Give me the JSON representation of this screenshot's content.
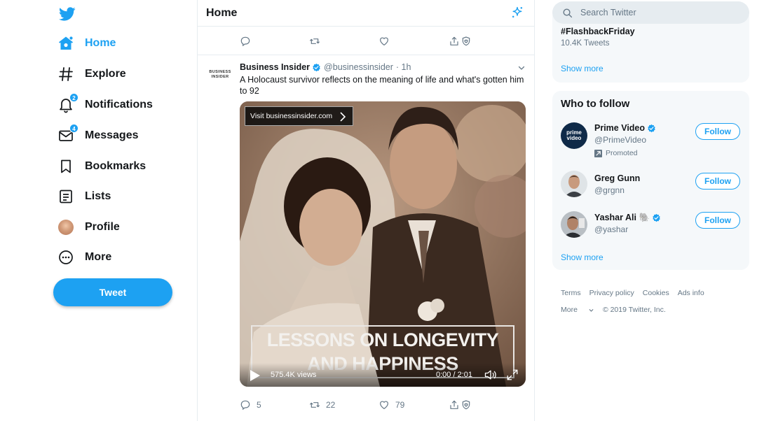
{
  "nav": {
    "items": [
      {
        "id": "home",
        "label": "Home",
        "icon": "home-icon",
        "active": true
      },
      {
        "id": "explore",
        "label": "Explore",
        "icon": "hashtag-icon"
      },
      {
        "id": "notifications",
        "label": "Notifications",
        "icon": "bell-icon",
        "badge": "2"
      },
      {
        "id": "messages",
        "label": "Messages",
        "icon": "envelope-icon",
        "badge": "4"
      },
      {
        "id": "bookmarks",
        "label": "Bookmarks",
        "icon": "bookmark-icon"
      },
      {
        "id": "lists",
        "label": "Lists",
        "icon": "list-icon"
      },
      {
        "id": "profile",
        "label": "Profile",
        "icon": "avatar"
      },
      {
        "id": "more",
        "label": "More",
        "icon": "more-circle-icon"
      }
    ],
    "tweet_button": "Tweet"
  },
  "colors": {
    "accent": "#1da1f2",
    "text": "#14171a",
    "muted": "#657786",
    "panel": "#f5f8fa"
  },
  "main": {
    "title": "Home",
    "tweet": {
      "author": "Business Insider",
      "handle": "@businessinsider",
      "time": "· 1h",
      "logo_text": "BUSINESS INSIDER",
      "text": "A Holocaust survivor reflects on the meaning of life and what's gotten him to 92",
      "media": {
        "visit_link": "Visit businessinsider.com",
        "caption_line1": "LESSONS ON LONGEVITY",
        "caption_line2": "AND HAPPINESS",
        "views": "575.4K views",
        "time": "0:00 / 2:01"
      },
      "replies": "5",
      "retweets": "22",
      "likes": "79"
    }
  },
  "sidebar": {
    "search_placeholder": "Search Twitter",
    "trend": {
      "name": "#FlashbackFriday",
      "count": "10.4K Tweets",
      "show_more": "Show more"
    },
    "who_to_follow": {
      "title": "Who to follow",
      "accounts": [
        {
          "name": "Prime Video",
          "handle": "@PrimeVideo",
          "verified": true,
          "promoted": "Promoted",
          "follow": "Follow",
          "avatar_text": "prime video"
        },
        {
          "name": "Greg Gunn",
          "handle": "@grgnn",
          "follow": "Follow"
        },
        {
          "name": "Yashar Ali 🐘",
          "handle": "@yashar",
          "verified": true,
          "follow": "Follow"
        }
      ],
      "show_more": "Show more"
    },
    "footer": {
      "links": [
        "Terms",
        "Privacy policy",
        "Cookies",
        "Ads info"
      ],
      "more": "More",
      "copyright": "© 2019 Twitter, Inc."
    }
  }
}
